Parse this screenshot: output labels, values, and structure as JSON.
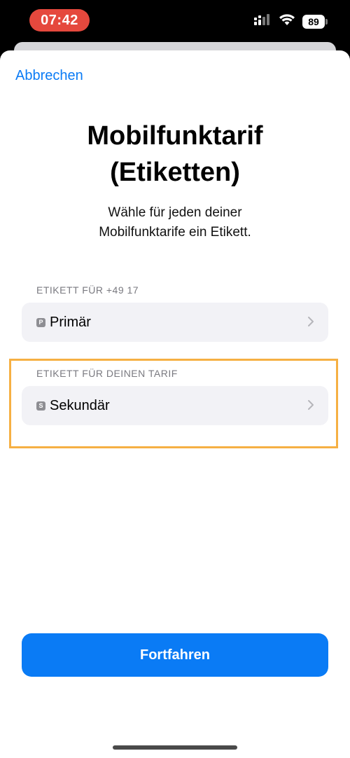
{
  "status_bar": {
    "time": "07:42",
    "battery": "89",
    "icons": [
      "signal-icon",
      "wifi-icon",
      "battery-icon"
    ],
    "time_pill_color": "#e5483d"
  },
  "nav": {
    "cancel_label": "Abbrechen"
  },
  "header": {
    "title_line1": "Mobilfunktarif",
    "title_line2": "(Etiketten)",
    "subtitle_line1": "Wähle für jeden deiner",
    "subtitle_line2": "Mobilfunktarife ein Etikett."
  },
  "sections": [
    {
      "header": "ETIKETT FÜR +49 17",
      "badge": "P",
      "label": "Primär"
    },
    {
      "header": "ETIKETT FÜR DEINEN TARIF",
      "badge": "S",
      "label": "Sekundär"
    }
  ],
  "footer": {
    "continue_label": "Fortfahren"
  },
  "colors": {
    "accent": "#0a7bf5",
    "highlight": "#f6b043",
    "row_background": "#f2f2f6"
  }
}
